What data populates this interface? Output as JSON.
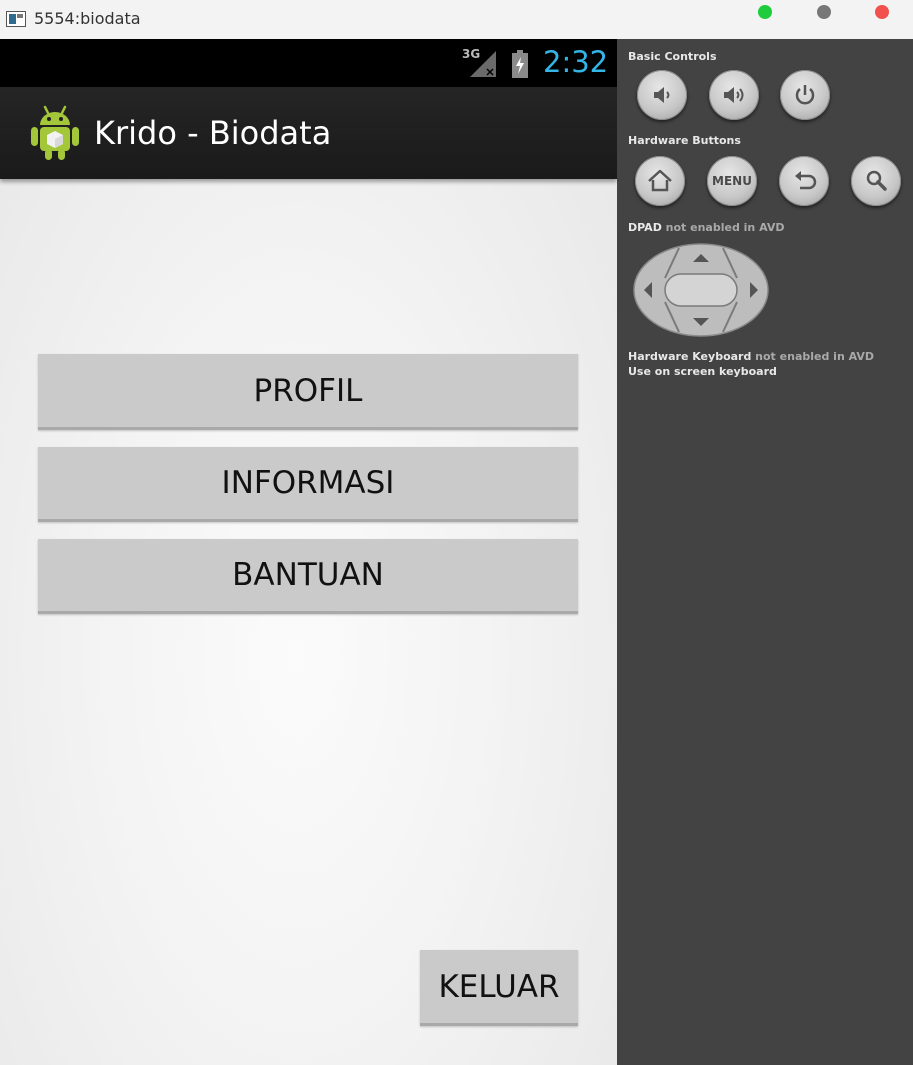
{
  "window": {
    "title": "5554:biodata"
  },
  "status_bar": {
    "network": "3G",
    "time": "2:32"
  },
  "action_bar": {
    "title": "Krido - Biodata"
  },
  "main": {
    "profil_label": "PROFIL",
    "informasi_label": "INFORMASI",
    "bantuan_label": "BANTUAN",
    "keluar_label": "KELUAR"
  },
  "panel": {
    "basic_controls_label": "Basic Controls",
    "hardware_buttons_label": "Hardware Buttons",
    "dpad_label_bold": "DPAD",
    "dpad_label_rest": " not enabled in AVD",
    "keyboard_label_bold": "Hardware Keyboard",
    "keyboard_label_rest": " not enabled in AVD",
    "onscreen_keyboard_label": "Use on screen keyboard",
    "menu_button_label": "MENU",
    "icons": [
      "volume-down-icon",
      "volume-up-icon",
      "power-icon",
      "home-icon",
      "menu-button",
      "back-icon",
      "search-icon"
    ]
  },
  "colors": {
    "clock": "#33b5e5",
    "screen_bg": "#f0f0f0",
    "button_bg": "#cacaca",
    "panel_bg": "#434343",
    "android_green": "#a4c639"
  }
}
